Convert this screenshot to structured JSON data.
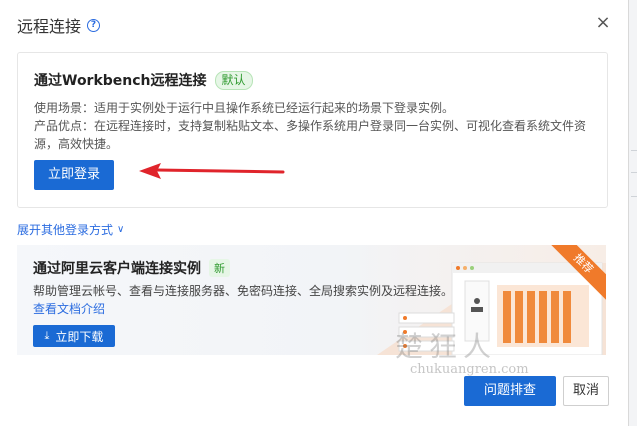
{
  "dialog": {
    "title": "远程连接",
    "help_icon": "help-icon",
    "close_icon": "close-icon",
    "close_glyph": "×"
  },
  "workbench": {
    "title": "通过Workbench远程连接",
    "badge": "默认",
    "usage": "使用场景：适用于实例处于运行中且操作系统已经运行起来的场景下登录实例。",
    "advantage_line1": "产品优点：在远程连接时，支持复制粘贴文本、多操作系统用户登录同一台实例、可视化查看系统文件资",
    "advantage_line2": "源，高效快捷。",
    "login_button": "立即登录"
  },
  "expand": {
    "label": "展开其他登录方式",
    "chevron": "∨"
  },
  "promo": {
    "title": "通过阿里云客户端连接实例",
    "badge": "新",
    "description": "帮助管理云帐号、查看与连接服务器、免密码连接、全局搜索实例及远程连接。",
    "doc_link": "查看文档介绍",
    "download_button": "立即下载",
    "download_icon": "download-icon",
    "ribbon": "推荐"
  },
  "watermark": {
    "text": "楚狂人",
    "url": "chukuangren.com"
  },
  "footer": {
    "diagnose_button": "问题排查",
    "cancel_button": "取消"
  },
  "colors": {
    "primary": "#1a6ad4",
    "link": "#2b6ce0",
    "badge_green": "#2f9a2f",
    "arrow_red": "#e0242b",
    "ribbon_orange": "#f07a2a"
  }
}
